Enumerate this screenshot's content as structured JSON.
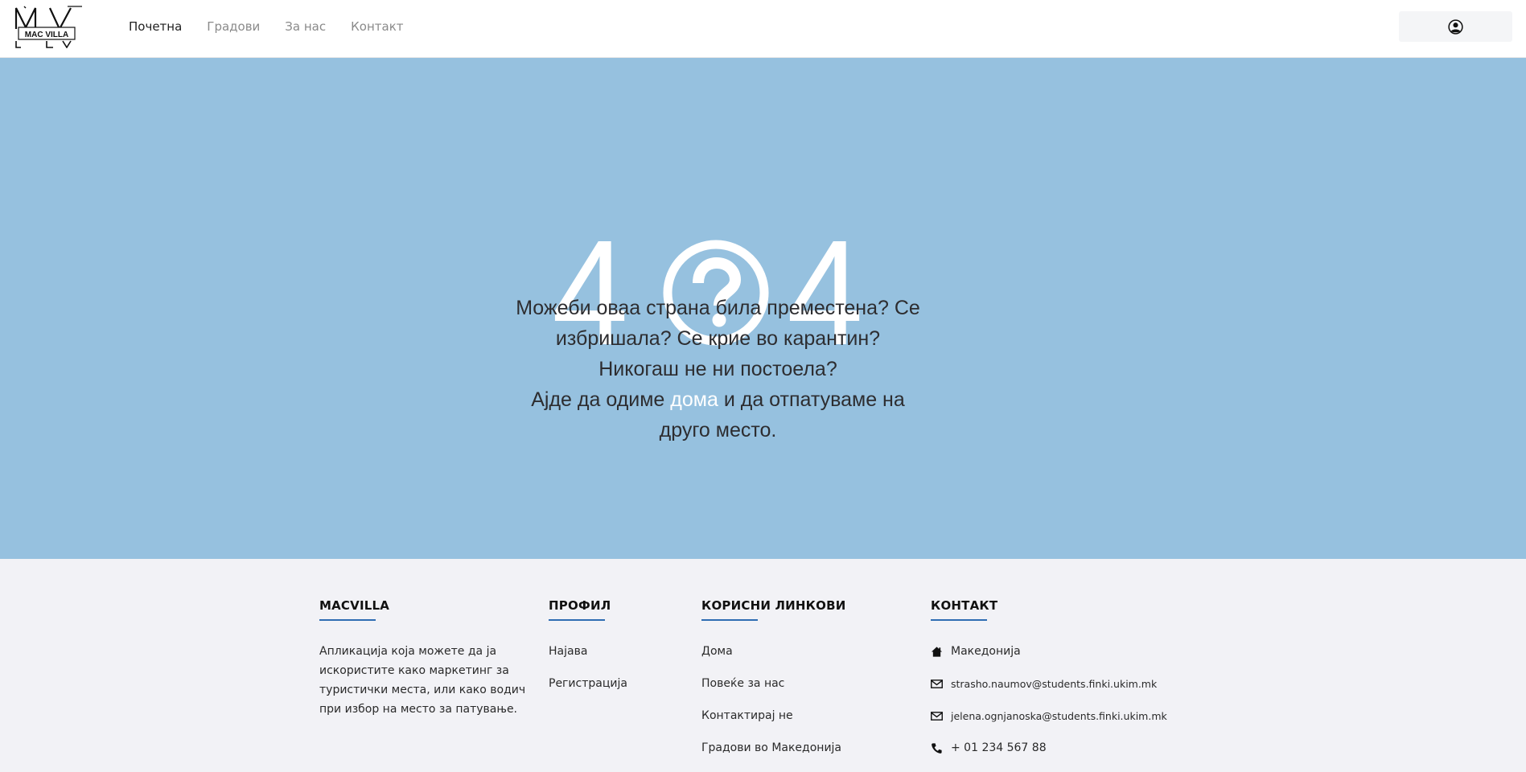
{
  "nav": {
    "logo_text": "MAC VILLA",
    "links": [
      {
        "label": "Почетна",
        "active": true
      },
      {
        "label": "Градови",
        "active": false
      },
      {
        "label": "За нас",
        "active": false
      },
      {
        "label": "Контакт",
        "active": false
      }
    ],
    "user_icon": "user-circle-icon"
  },
  "hero": {
    "background": "#96c1df",
    "code_left": "4",
    "code_icon": "question-circle-icon",
    "code_right": "4",
    "message": "Можеби оваа страна била преместена? Се избришала? Се крие во карантин? Никогаш не ни постоела?",
    "cta_before": "Ајде да одиме ",
    "cta_link": "дома",
    "cta_after": " и да отпатуваме на друго место."
  },
  "footer": {
    "accent_color": "#2f6db3",
    "about": {
      "heading": "MACVILLA",
      "text": "Апликација која можете да ја искористите како маркетинг за туристички места, или како водич при избор на место за патување."
    },
    "profile": {
      "heading": "ПРОФИЛ",
      "links": [
        "Најава",
        "Регистрација"
      ]
    },
    "useful": {
      "heading": "КОРИСНИ ЛИНКОВИ",
      "links": [
        "Дома",
        "Повеќе за нас",
        "Контактирај не",
        "Градови во Македонија"
      ]
    },
    "contact": {
      "heading": "КОНТАКТ",
      "location": "Македонија",
      "email1": "strasho.naumov@students.finki.ukim.mk",
      "email2": "jelena.ognjanoska@students.finki.ukim.mk",
      "phone": "+ 01 234 567 88"
    }
  }
}
